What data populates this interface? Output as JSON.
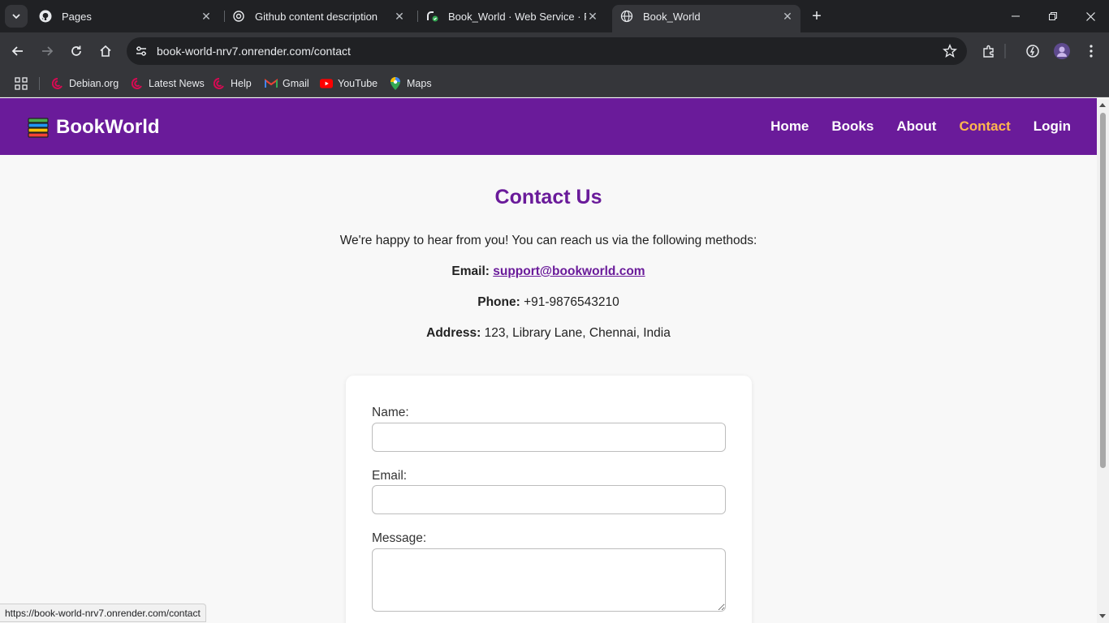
{
  "browser": {
    "tabs": [
      {
        "title": "Pages",
        "icon": "github-icon"
      },
      {
        "title": "Github content description",
        "icon": "openai-icon"
      },
      {
        "title": "Book_World · Web Service · Re",
        "icon": "render-icon"
      },
      {
        "title": "Book_World",
        "icon": "globe-icon",
        "active": true
      }
    ],
    "url": "book-world-nrv7.onrender.com/contact",
    "bookmarks": [
      {
        "label": "Debian.org",
        "icon": "debian-icon"
      },
      {
        "label": "Latest News",
        "icon": "debian-icon"
      },
      {
        "label": "Help",
        "icon": "debian-icon"
      },
      {
        "label": "Gmail",
        "icon": "gmail-icon"
      },
      {
        "label": "YouTube",
        "icon": "youtube-icon"
      },
      {
        "label": "Maps",
        "icon": "maps-icon"
      }
    ],
    "status_url": "https://book-world-nrv7.onrender.com/contact"
  },
  "site": {
    "brand": "BookWorld",
    "nav": [
      {
        "label": "Home"
      },
      {
        "label": "Books"
      },
      {
        "label": "About"
      },
      {
        "label": "Contact",
        "active": true
      },
      {
        "label": "Login"
      }
    ],
    "colors": {
      "primary": "#6a1b9a",
      "active_nav": "#ffb74d",
      "background": "#f8f8f8"
    }
  },
  "contact": {
    "heading": "Contact Us",
    "intro": "We're happy to hear from you! You can reach us via the following methods:",
    "email_label": "Email:",
    "email_value": "support@bookworld.com",
    "phone_label": "Phone:",
    "phone_value": "+91-9876543210",
    "address_label": "Address:",
    "address_value": "123, Library Lane, Chennai, India"
  },
  "form": {
    "name_label": "Name:",
    "email_label": "Email:",
    "message_label": "Message:"
  }
}
